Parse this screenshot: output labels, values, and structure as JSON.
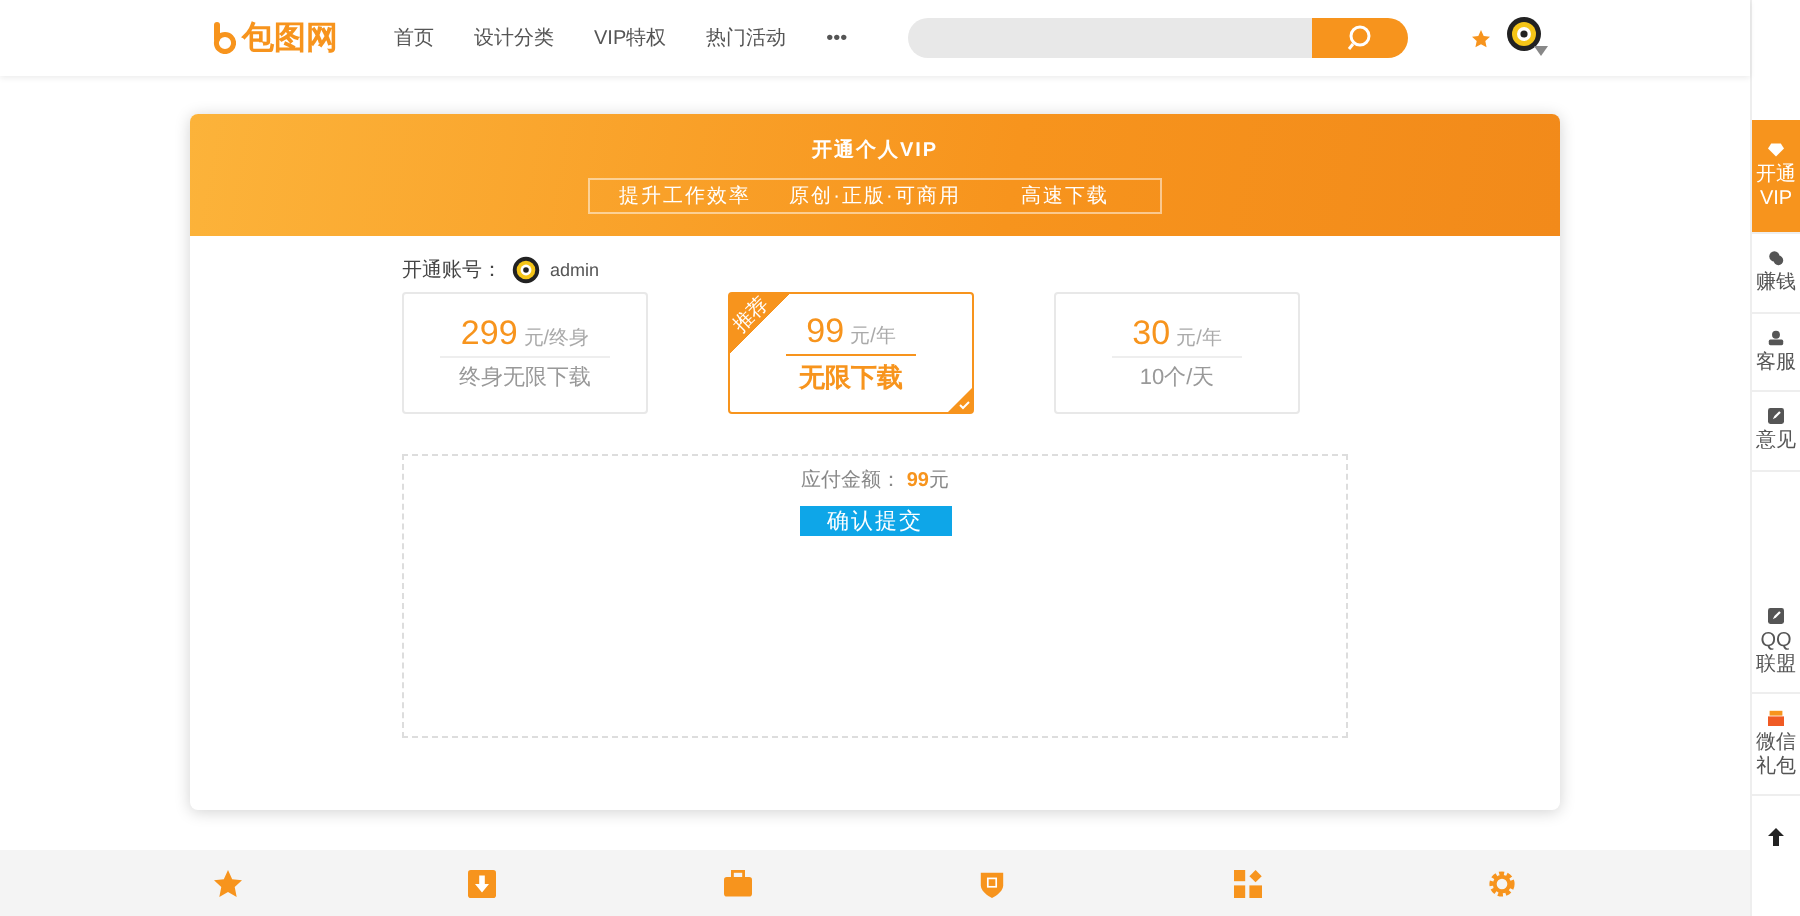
{
  "header": {
    "logo": "包图网",
    "nav": [
      "首页",
      "设计分类",
      "VIP特权",
      "热门活动",
      "•••"
    ]
  },
  "banner": {
    "title": "开通个人VIP",
    "features": [
      "提升工作效率",
      "原创·正版·可商用",
      "高速下载"
    ]
  },
  "account": {
    "label": "开通账号：",
    "username": "admin"
  },
  "plans": [
    {
      "price": "299",
      "unit": "元/终身",
      "description": "终身无限下载",
      "selected": false
    },
    {
      "price": "99",
      "unit": "元/年",
      "description": "无限下载",
      "selected": true,
      "badge": "推荐"
    },
    {
      "price": "30",
      "unit": "元/年",
      "description": "10个/天",
      "selected": false
    }
  ],
  "payment": {
    "amount_text": "应付金额： **99**元",
    "submit": "确认提交"
  },
  "sidebar": {
    "top_items": [
      {
        "kind": "vip",
        "label": "开通VIP",
        "selected": true
      },
      {
        "kind": "money",
        "label": "赚钱",
        "selected": false
      },
      {
        "kind": "service",
        "label": "客服",
        "selected": false
      },
      {
        "kind": "feedback",
        "label": "意见",
        "selected": false
      }
    ],
    "bottom_items": [
      {
        "kind": "qq",
        "label": "QQ联盟",
        "selected": false
      },
      {
        "kind": "gift",
        "label": "微信礼包",
        "selected": false
      }
    ]
  }
}
